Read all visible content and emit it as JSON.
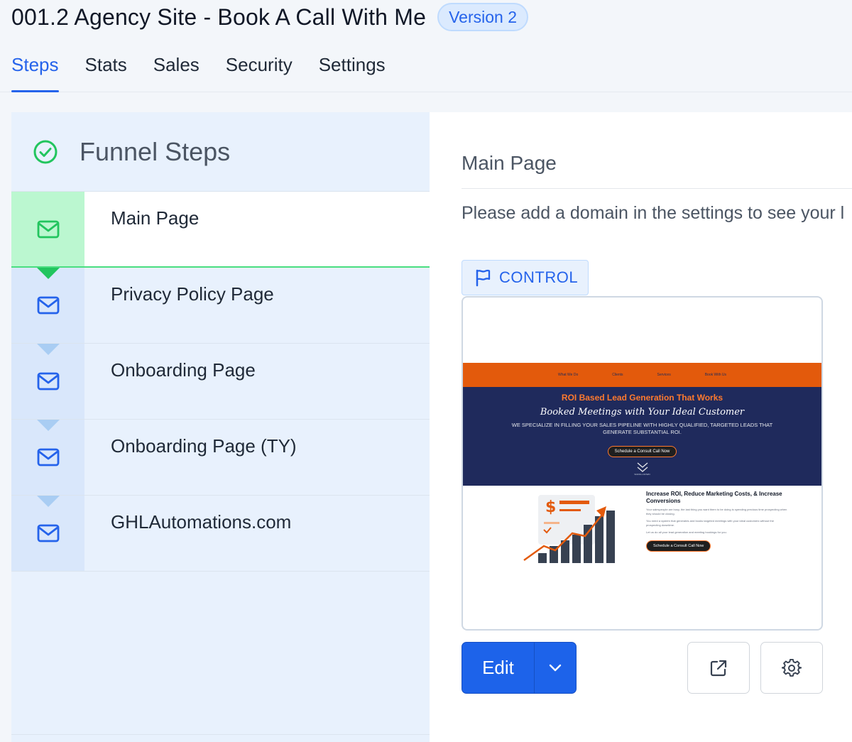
{
  "header": {
    "title": "001.2 Agency Site - Book A Call With Me",
    "version_badge": "Version 2",
    "tabs": [
      {
        "label": "Steps",
        "active": true
      },
      {
        "label": "Stats",
        "active": false
      },
      {
        "label": "Sales",
        "active": false
      },
      {
        "label": "Security",
        "active": false
      },
      {
        "label": "Settings",
        "active": false
      }
    ]
  },
  "sidebar": {
    "title": "Funnel Steps",
    "steps": [
      {
        "label": "Main Page",
        "icon": "mail-icon",
        "active": true
      },
      {
        "label": "Privacy Policy Page",
        "icon": "mail-icon",
        "active": false
      },
      {
        "label": "Onboarding Page",
        "icon": "mail-icon",
        "active": false
      },
      {
        "label": "Onboarding Page (TY)",
        "icon": "mail-icon",
        "active": false
      },
      {
        "label": "GHLAutomations.com",
        "icon": "mail-icon",
        "active": false
      }
    ]
  },
  "main": {
    "title": "Main Page",
    "domain_note": "Please add a domain in the settings to see your l",
    "control_label": "CONTROL",
    "preview": {
      "nav": [
        "What We Do",
        "Clients",
        "Services",
        "Book With Us"
      ],
      "headline": "ROI Based Lead Generation That Works",
      "script_headline": "Booked Meetings with Your Ideal Customer",
      "subheadline": "WE SPECIALIZE IN FILLING YOUR SALES PIPELINE WITH HIGHLY QUALIFIED, TARGETED LEADS THAT GENERATE SUBSTANTIAL ROI.",
      "cta": "Schedule a Consult Call Now",
      "scroll": "SCROLL DOWN",
      "section_heading": "Increase ROI, Reduce Marketing Costs, & Increase Conversions",
      "paragraphs": [
        "Your salespeople are busy, the last thing you want them to be doing is spending precious time prospecting when they should be closing.",
        "You need a system that generates and books targeted meetings with your ideal customers without the prospecting downtime.",
        "Let us do all your lead generation and meeting bookings for you."
      ],
      "cta2": "Schedule a Consult Call Now"
    },
    "edit_label": "Edit"
  },
  "colors": {
    "accent": "#2563eb",
    "active_step": "#22c55e",
    "preview_orange": "#e35a0c",
    "preview_navy": "#1f2a5c"
  }
}
